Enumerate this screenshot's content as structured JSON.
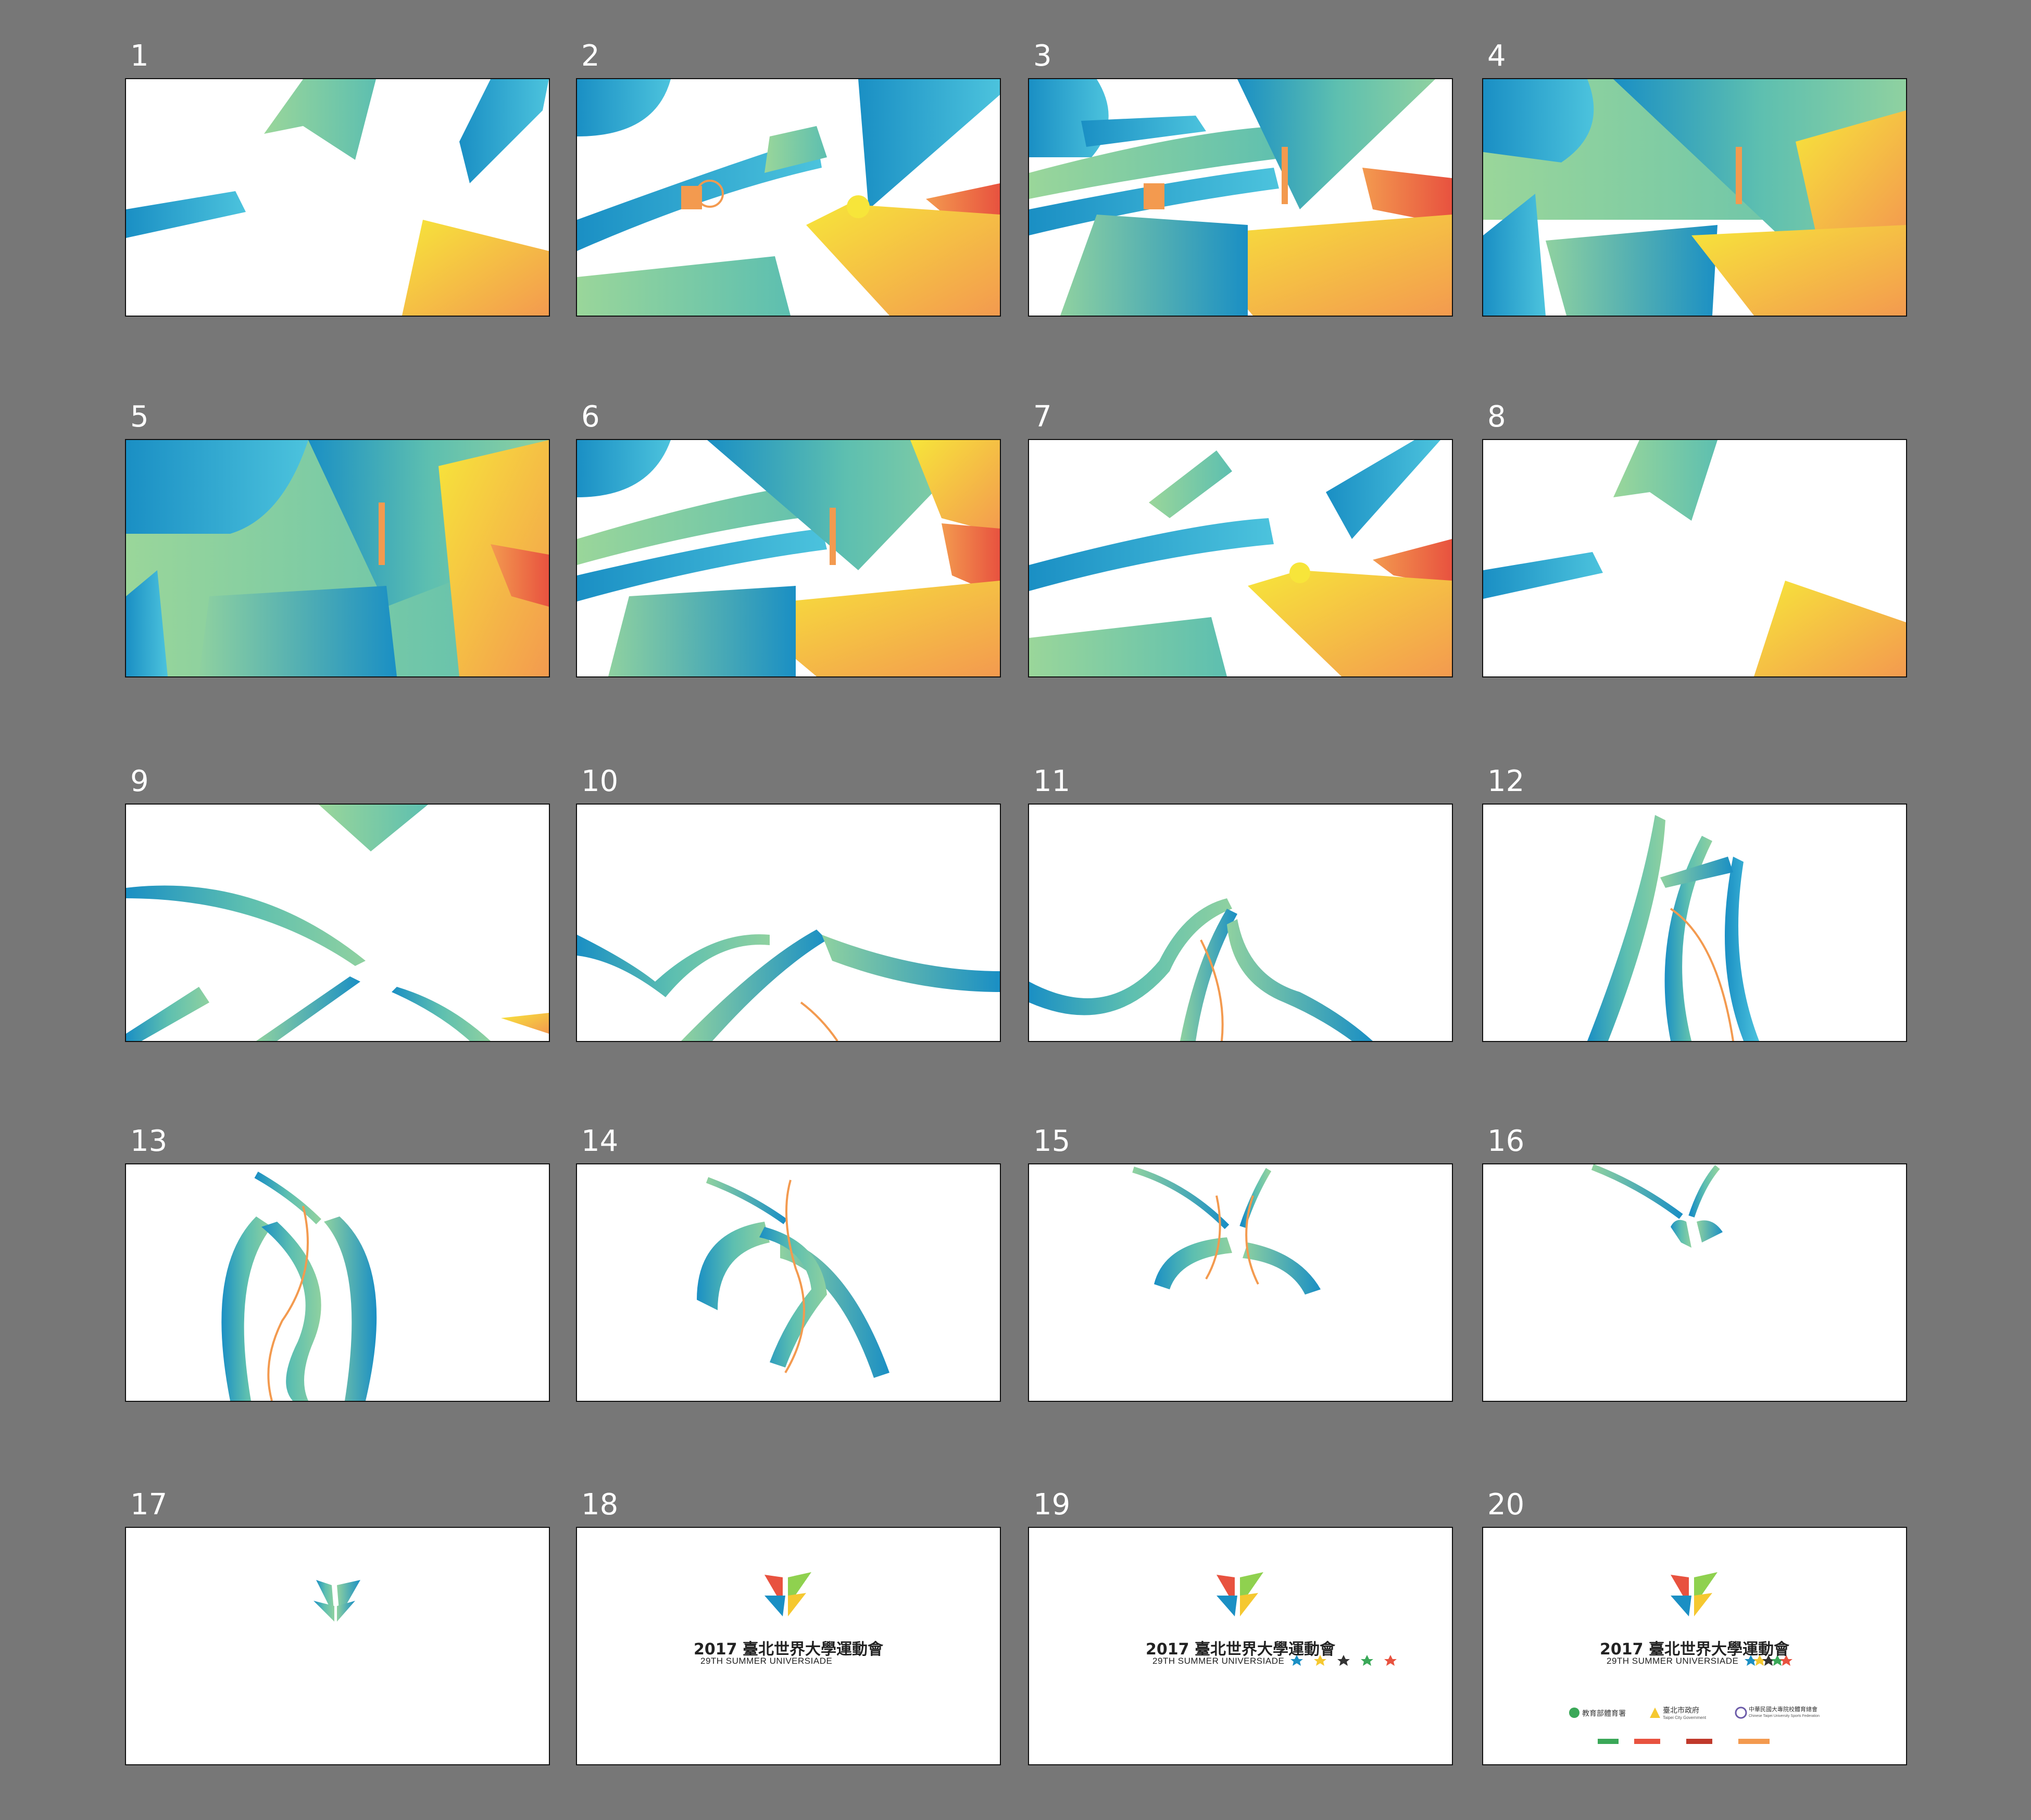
{
  "frames": [
    {
      "label": "1"
    },
    {
      "label": "2"
    },
    {
      "label": "3"
    },
    {
      "label": "4"
    },
    {
      "label": "5"
    },
    {
      "label": "6"
    },
    {
      "label": "7"
    },
    {
      "label": "8"
    },
    {
      "label": "9"
    },
    {
      "label": "10"
    },
    {
      "label": "11"
    },
    {
      "label": "12"
    },
    {
      "label": "13"
    },
    {
      "label": "14"
    },
    {
      "label": "15"
    },
    {
      "label": "16"
    },
    {
      "label": "17"
    },
    {
      "label": "18"
    },
    {
      "label": "19"
    },
    {
      "label": "20"
    }
  ],
  "logo": {
    "title": "2017 臺北世界大學運動會",
    "subtitle": "29TH SUMMER UNIVERSIADE"
  },
  "sponsors": {
    "sports_admin": "教育部體育署",
    "taipei_gov": "臺北市政府",
    "taipei_gov_en": "Taipei City Government",
    "ctusf": "中華民國大專院校體育總會",
    "ctusf_en": "Chinese Taipei University Sports Federation"
  },
  "colors": {
    "background": "#777777",
    "panel": "#ffffff",
    "blue": "#1a8fc4",
    "teal": "#5dbfb0",
    "green": "#8fd19e",
    "yellow": "#f5e03a",
    "orange": "#f39a4f",
    "red": "#e8523f"
  }
}
